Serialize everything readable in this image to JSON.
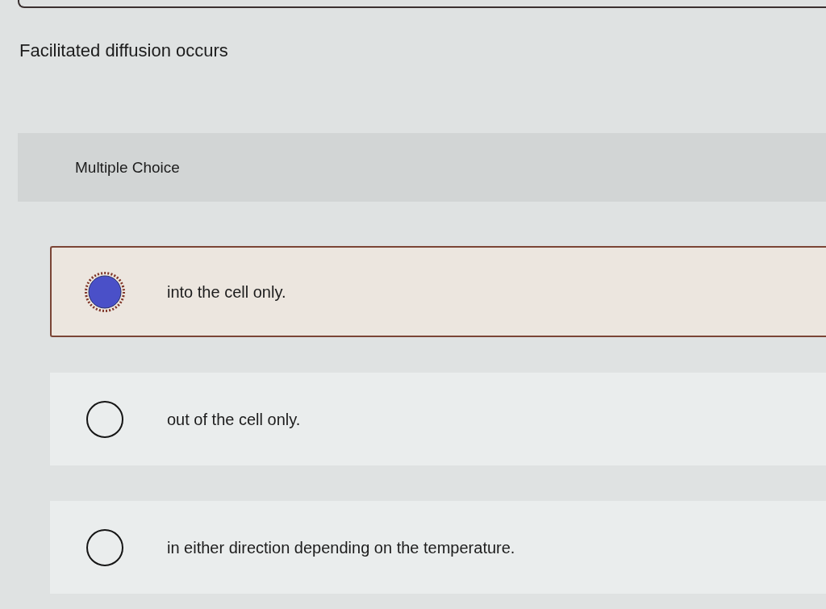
{
  "question": {
    "text": "Facilitated diffusion occurs"
  },
  "question_type": "Multiple Choice",
  "options": [
    {
      "label": "into the cell only.",
      "selected": true
    },
    {
      "label": "out of the cell only.",
      "selected": false
    },
    {
      "label": "in either direction depending on the temperature.",
      "selected": false
    }
  ]
}
